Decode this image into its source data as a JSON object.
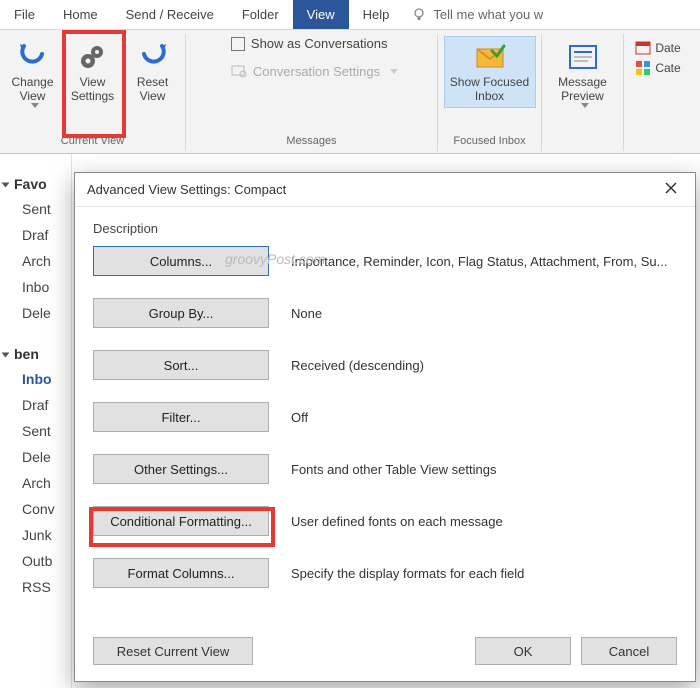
{
  "menubar": {
    "items": [
      "File",
      "Home",
      "Send / Receive",
      "Folder",
      "View",
      "Help"
    ],
    "active_index": 4,
    "tell_me": "Tell me what you w"
  },
  "ribbon": {
    "current_view": {
      "label": "Current View",
      "change": "Change View",
      "settings": "View Settings",
      "reset": "Reset View"
    },
    "messages": {
      "label": "Messages",
      "show_conv": "Show as Conversations",
      "conv_settings": "Conversation Settings"
    },
    "focused": {
      "label": "Focused Inbox",
      "button": "Show Focused Inbox"
    },
    "layout": {
      "msg_preview": "Message Preview"
    },
    "arrangement": {
      "date": "Date",
      "cate": "Cate"
    }
  },
  "nav": {
    "favorites": "Favo",
    "fav_items": [
      "Sent",
      "Draf",
      "Arch",
      "Inbo",
      "Dele"
    ],
    "account": "ben",
    "acct_items": [
      "Inbo",
      "Draf",
      "Sent",
      "Dele",
      "Arch",
      "Conv",
      "Junk",
      "Outb",
      "RSS"
    ]
  },
  "dialog": {
    "title": "Advanced View Settings: Compact",
    "description": "Description",
    "watermark": "groovyPost.com",
    "rows": [
      {
        "btn": "Columns...",
        "text": "Importance, Reminder, Icon, Flag Status, Attachment, From, Su..."
      },
      {
        "btn": "Group By...",
        "text": "None"
      },
      {
        "btn": "Sort...",
        "text": "Received (descending)"
      },
      {
        "btn": "Filter...",
        "text": "Off"
      },
      {
        "btn": "Other Settings...",
        "text": "Fonts and other Table View settings"
      },
      {
        "btn": "Conditional Formatting...",
        "text": "User defined fonts on each message"
      },
      {
        "btn": "Format Columns...",
        "text": "Specify the display formats for each field"
      }
    ],
    "reset": "Reset Current View",
    "ok": "OK",
    "cancel": "Cancel"
  }
}
